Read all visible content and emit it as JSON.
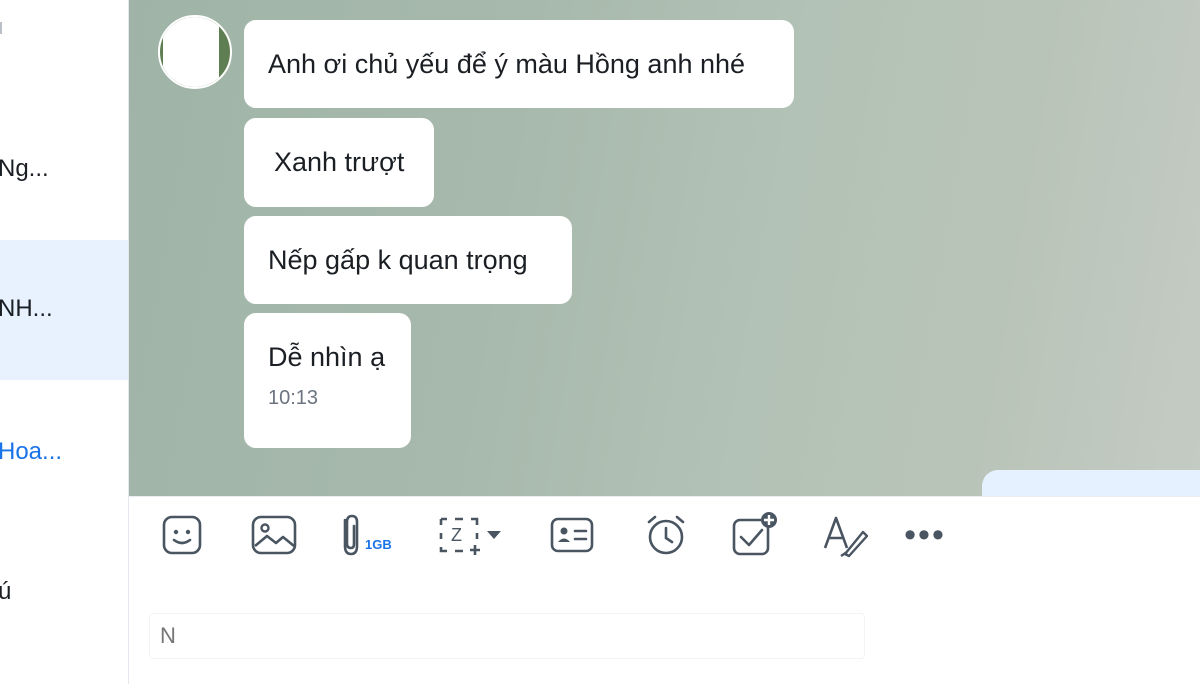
{
  "sidebar": {
    "conversations": [
      {
        "name": "Ng..."
      },
      {
        "name": "NH..."
      },
      {
        "name": "Hoa..."
      },
      {
        "name": "ú"
      }
    ]
  },
  "chat": {
    "messages": [
      {
        "text": "Anh ơi chủ yếu để ý màu Hồng anh nhé"
      },
      {
        "text": "Xanh trượt"
      },
      {
        "text": "Nếp gấp k quan trọng"
      },
      {
        "text": "Dễ nhìn ạ",
        "time": "10:13"
      }
    ]
  },
  "toolbar": {
    "file_quota": "1GB",
    "more_label": "•••",
    "icons": [
      "sticker-icon",
      "image-icon",
      "attachment-icon",
      "screenshot-icon",
      "contact-card-icon",
      "alarm-icon",
      "todo-icon",
      "text-format-icon",
      "more-icon"
    ]
  },
  "composer": {
    "placeholder": "N"
  },
  "colors": {
    "accent": "#1a73e8",
    "active_row": "#e8f2ff",
    "sent_bubble": "#e5f1ff",
    "icon": "#4a5562"
  }
}
